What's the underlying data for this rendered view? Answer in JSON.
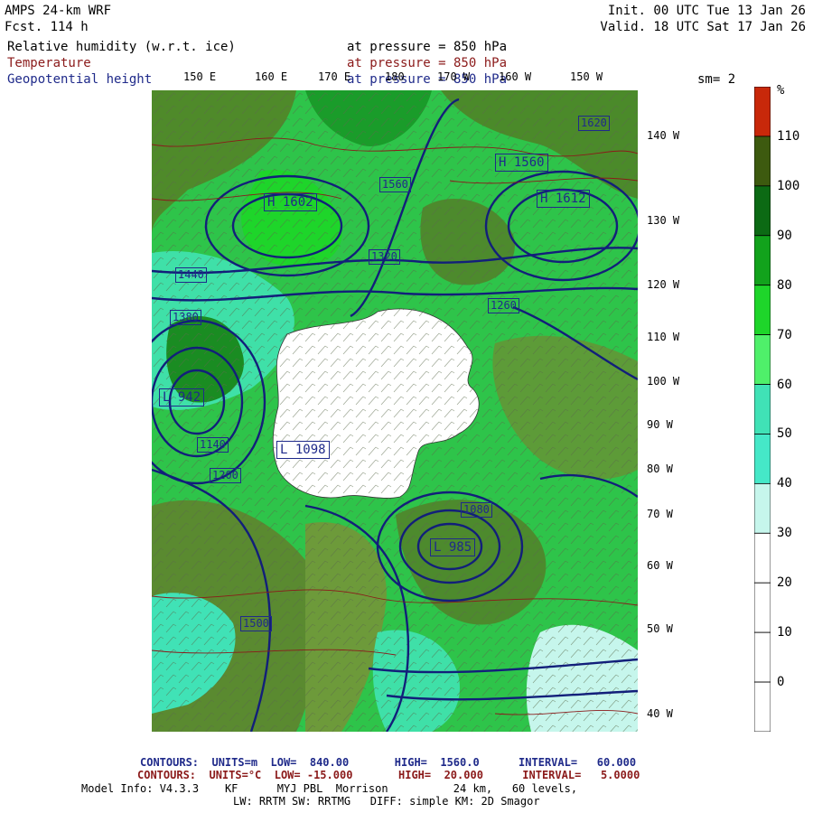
{
  "header": {
    "title": "AMPS 24-km WRF",
    "fcst": "Fcst. 114 h",
    "init": "Init. 00 UTC Tue 13 Jan 26",
    "valid": "Valid. 18 UTC Sat 17 Jan 26"
  },
  "fields": [
    {
      "name": "Relative humidity (w.r.t. ice)",
      "level": "at pressure = 850 hPa",
      "color": "#000000"
    },
    {
      "name": "Temperature",
      "level": "at pressure = 850 hPa",
      "color": "#8b1a1a"
    },
    {
      "name": "Geopotential height",
      "level": "at pressure = 850 hPa",
      "color": "#1f2a8a"
    }
  ],
  "smoothing": "sm= 2",
  "lon_labels": [
    "150 E",
    "160 E",
    "170 E",
    "180",
    "170 W",
    "160 W",
    "150 W"
  ],
  "lat_labels": [
    "140 W",
    "130 W",
    "120 W",
    "110 W",
    "100 W",
    "90 W",
    "80 W",
    "70 W",
    "60 W",
    "50 W",
    "40 W"
  ],
  "colorbar": {
    "unit": "%",
    "levels": [
      "110",
      "100",
      "90",
      "80",
      "70",
      "60",
      "50",
      "40",
      "30",
      "20",
      "10",
      "0"
    ],
    "colors": [
      "#c8280a",
      "#3d5a0f",
      "#0c6a14",
      "#12a21c",
      "#1ed52a",
      "#4ff06a",
      "#40e2b6",
      "#45e8c8",
      "#c6f6ec",
      "#ffffff",
      "#ffffff",
      "#ffffff",
      "#ffffff"
    ]
  },
  "map_labels": {
    "highs": [
      {
        "text": "H",
        "value": "1602"
      },
      {
        "text": "H",
        "value": "1612"
      },
      {
        "text": "H",
        "value": "1560"
      }
    ],
    "lows": [
      {
        "text": "L",
        "value": "942"
      },
      {
        "text": "L",
        "value": "1098"
      },
      {
        "text": "L",
        "value": "985"
      }
    ],
    "contour_values": [
      "1440",
      "1380",
      "1320",
      "1260",
      "1200",
      "1140",
      "1080",
      "1500",
      "1560",
      "1620"
    ]
  },
  "footer": {
    "line1_label": "CONTOURS:",
    "line1": "UNITS=m  LOW=  840.00       HIGH=  1560.0      INTERVAL=   60.000",
    "line2_label": "CONTOURS:",
    "line2": "UNITS=°C  LOW= -15.000       HIGH=  20.000      INTERVAL=   5.0000",
    "line3": "Model Info: V4.3.3    KF      MYJ PBL  Morrison          24 km,   60 levels,",
    "line4": "LW: RRTM SW: RRTMG   DIFF: simple KM: 2D Smagor"
  }
}
